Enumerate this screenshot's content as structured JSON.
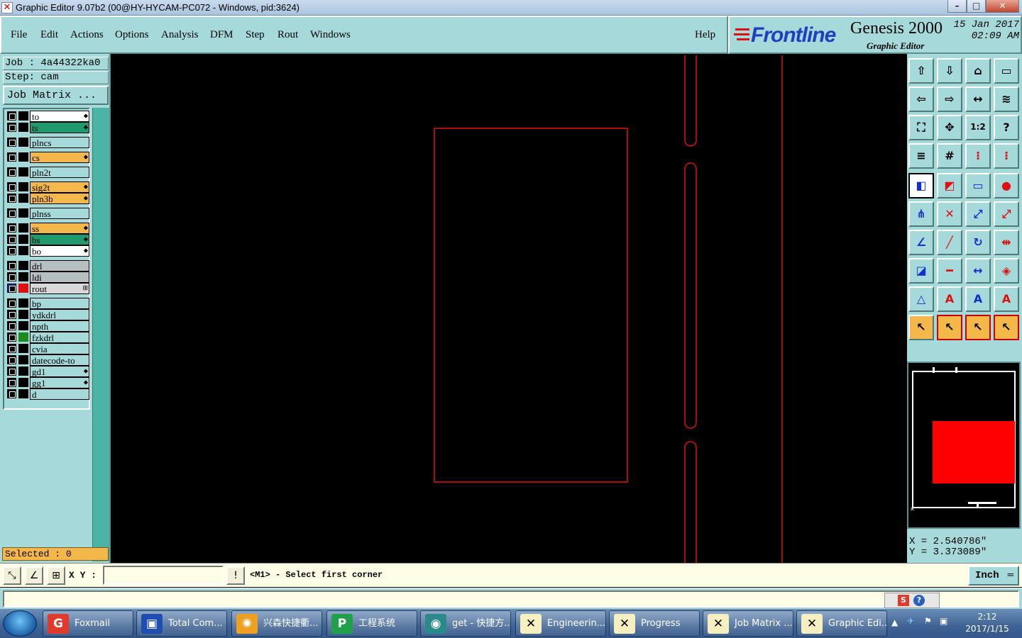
{
  "window": {
    "title": "Graphic Editor 9.07b2 (00@HY-HYCAM-PC072 - Windows, pid:3624)",
    "min_glyph": "–",
    "max_glyph": "□",
    "close_glyph": "✕"
  },
  "menu": {
    "items": [
      "File",
      "Edit",
      "Actions",
      "Options",
      "Analysis",
      "DFM",
      "Step",
      "Rout",
      "Windows"
    ],
    "help": "Help"
  },
  "brand": {
    "logo": "Frontline",
    "product": "Genesis 2000",
    "subtitle": "Graphic Editor",
    "date": "15 Jan 2017",
    "time": "02:09 AM"
  },
  "job": {
    "job_line": "Job : 4a44322ka0",
    "step_line": "Step: cam",
    "matrix_button": "Job Matrix ..."
  },
  "layers": [
    {
      "name": "to",
      "bg": "#ffffff",
      "mark": "⬥"
    },
    {
      "name": "ts",
      "bg": "#1f9a6e",
      "mark": "⬥"
    },
    {
      "name": "plncs",
      "bg": "#a6dada",
      "mark": ""
    },
    {
      "name": "cs",
      "bg": "#f4b84a",
      "mark": "⬥"
    },
    {
      "name": "pln2t",
      "bg": "#a6dada",
      "mark": ""
    },
    {
      "name": "sig2t",
      "bg": "#f4b84a",
      "mark": "⬥"
    },
    {
      "name": "pln3b",
      "bg": "#f4b84a",
      "mark": "⬥"
    },
    {
      "name": "plnss",
      "bg": "#a6dada",
      "mark": ""
    },
    {
      "name": "ss",
      "bg": "#f4b84a",
      "mark": "⬥"
    },
    {
      "name": "bs",
      "bg": "#1f9a6e",
      "mark": "⬥"
    },
    {
      "name": "bo",
      "bg": "#ffffff",
      "mark": "⬥"
    },
    {
      "name": "drl",
      "bg": "#b7c0c0",
      "mark": ""
    },
    {
      "name": "ldi",
      "bg": "#b7c0c0",
      "mark": ""
    },
    {
      "name": "rout",
      "bg": "#d9d9d9",
      "mark": "⊞",
      "color": "#e01010",
      "active": true
    },
    {
      "name": "bp",
      "bg": "#a6dada",
      "mark": ""
    },
    {
      "name": "ydkdrl",
      "bg": "#a6dada",
      "mark": ""
    },
    {
      "name": "npth",
      "bg": "#a6dada",
      "mark": ""
    },
    {
      "name": "fzkdrl",
      "bg": "#a6dada",
      "mark": "",
      "color": "#1e8a1e"
    },
    {
      "name": "cvia",
      "bg": "#a6dada",
      "mark": ""
    },
    {
      "name": "datecode-to",
      "bg": "#a6dada",
      "mark": ""
    },
    {
      "name": "gd1",
      "bg": "#a6dada",
      "mark": "⬥"
    },
    {
      "name": "gg1",
      "bg": "#a6dada",
      "mark": "⬥"
    },
    {
      "name": "d",
      "bg": "#a6dada",
      "mark": ""
    }
  ],
  "selected": "Selected : 0",
  "coords": {
    "x": "X = 2.540786\"",
    "y": "Y = 3.373089\""
  },
  "command": {
    "xy_label": "X Y :",
    "xy_value": "",
    "prompt": "<M1> - Select first corner",
    "units": "Inch"
  },
  "taskbar": {
    "items": [
      {
        "label": "Foxmail",
        "icon": "G",
        "icon_color": "#e03a2a"
      },
      {
        "label": "Total Com...",
        "icon": "▣",
        "icon_color": "#1e4fb0"
      },
      {
        "label": "兴森快捷衢...",
        "icon": "✺",
        "icon_color": "#f0a020"
      },
      {
        "label": "工程系统",
        "icon": "P",
        "icon_color": "#21a04a"
      },
      {
        "label": "get - 快捷方...",
        "icon": "◉",
        "icon_color": "#2a8a8a"
      },
      {
        "label": "Engineerin...",
        "icon": "✕",
        "icon_color": "#f6f0c0"
      },
      {
        "label": "Progress",
        "icon": "✕",
        "icon_color": "#f6f0c0"
      },
      {
        "label": "Job Matrix ...",
        "icon": "✕",
        "icon_color": "#f6f0c0"
      },
      {
        "label": "Graphic Edi...",
        "icon": "✕",
        "icon_color": "#f6f0c0"
      }
    ],
    "clock_time": "2:12",
    "clock_date": "2017/1/15"
  },
  "colors": {
    "panel": "#a6dada",
    "rout": "#e01010",
    "accent": "#f4b84a"
  },
  "toolbar_icons": [
    "top-view-icon",
    "bottom-view-icon",
    "home-icon",
    "window-icon",
    "zoom-prev-icon",
    "zoom-next-icon",
    "flip-icon",
    "redraw-icon",
    "fit-icon",
    "zoom-icon",
    "scale-1-2-icon",
    "help-icon",
    "measure-icon",
    "grid-icon",
    "layers-compare-icon",
    "layers-compare2-icon",
    "pad-icon",
    "line-icon",
    "ruler-icon",
    "circle-icon",
    "connect-icon",
    "cross-icon",
    "arc-icon",
    "point-icon",
    "angle-icon",
    "diagonal-icon",
    "rotate-icon",
    "mirror-icon",
    "node-icon",
    "line-h-icon",
    "snap-icon",
    "shapes-icon",
    "triangle-icon",
    "text-a-icon",
    "text-a2-icon",
    "text-a3-icon",
    "select-icon",
    "select-box-icon",
    "select-circle-icon",
    "select-path-icon"
  ]
}
